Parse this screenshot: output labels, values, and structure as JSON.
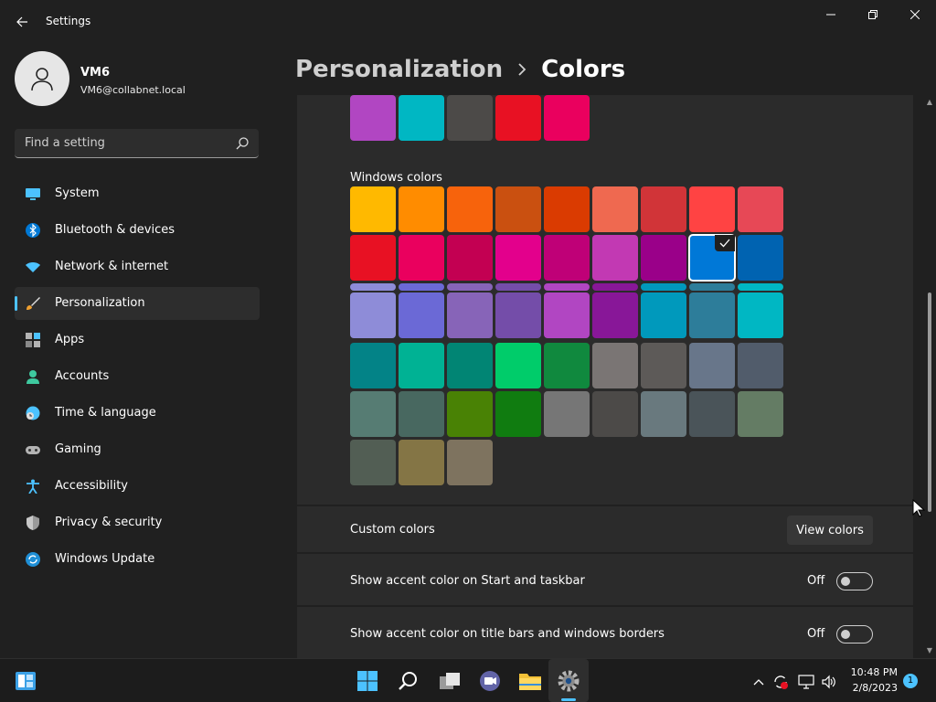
{
  "window": {
    "title": "Settings"
  },
  "profile": {
    "name": "VM6",
    "email": "VM6@collabnet.local"
  },
  "search": {
    "placeholder": "Find a setting"
  },
  "sidebar": {
    "items": [
      {
        "label": "System",
        "icon": "monitor-icon"
      },
      {
        "label": "Bluetooth & devices",
        "icon": "bluetooth-icon"
      },
      {
        "label": "Network & internet",
        "icon": "wifi-icon"
      },
      {
        "label": "Personalization",
        "icon": "brush-icon",
        "active": true
      },
      {
        "label": "Apps",
        "icon": "apps-icon"
      },
      {
        "label": "Accounts",
        "icon": "person-icon"
      },
      {
        "label": "Time & language",
        "icon": "clock-globe-icon"
      },
      {
        "label": "Gaming",
        "icon": "gamepad-icon"
      },
      {
        "label": "Accessibility",
        "icon": "accessibility-icon"
      },
      {
        "label": "Privacy & security",
        "icon": "shield-icon"
      },
      {
        "label": "Windows Update",
        "icon": "update-icon"
      }
    ]
  },
  "breadcrumb": {
    "parent": "Personalization",
    "current": "Colors"
  },
  "recent_colors": [
    "#b146c2",
    "#00b7c3",
    "#4c4a48",
    "#e81123",
    "#ea005e"
  ],
  "windows_colors": {
    "label": "Windows colors",
    "selected": "#0078d7",
    "rows": [
      [
        "#ffb900",
        "#ff8c00",
        "#f7630c",
        "#ca5010",
        "#da3b01",
        "#ef6950",
        "#d13438",
        "#ff4343",
        "#e74856"
      ],
      [
        "#e81123",
        "#ea005e",
        "#c30052",
        "#e3008c",
        "#bf0077",
        "#c239b3",
        "#9a0089",
        "#0078d7",
        "#0063b1"
      ],
      [
        "#8e8cd8",
        "#6b69d6",
        "#8764b8",
        "#744da9",
        "#b146c2",
        "#881798",
        "#0099bc",
        "#2d7d9a",
        "#00b7c3"
      ],
      [
        "#038387",
        "#00b294",
        "#018574",
        "#00cc6a",
        "#10893e",
        "#7a7574",
        "#5d5a58",
        "#68768a",
        "#515c6b"
      ],
      [
        "#567c73",
        "#486860",
        "#498205",
        "#107c10",
        "#767676",
        "#4c4a48",
        "#69797e",
        "#4a5459",
        "#647c64"
      ],
      [
        "#525e54",
        "#847545",
        "#7e735f"
      ]
    ]
  },
  "custom_colors": {
    "label": "Custom colors",
    "button": "View colors"
  },
  "accent_start": {
    "label": "Show accent color on Start and taskbar",
    "state": "Off"
  },
  "accent_titlebars": {
    "label": "Show accent color on title bars and windows borders",
    "state": "Off"
  },
  "taskbar": {
    "time": "10:48 PM",
    "date": "2/8/2023",
    "notifications": "1"
  }
}
